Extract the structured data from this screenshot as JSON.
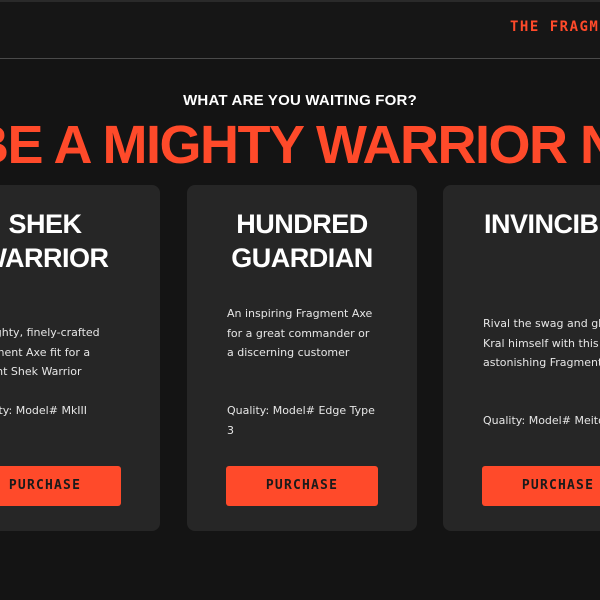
{
  "header": {
    "brand": "THE FRAGMENT"
  },
  "hero": {
    "eyebrow": "WHAT ARE YOU WAITING FOR?",
    "headline": "BE A MIGHTY WARRIOR NOW!"
  },
  "cards": [
    {
      "title_line1": "SHEK",
      "title_line2": "WARRIOR",
      "description": "A mighty, finely-crafted Fragment Axe fit for a valiant Shek Warrior",
      "quality": "Quality: Model# MkIII",
      "button_label": "PURCHASE"
    },
    {
      "title_line1": "HUNDRED",
      "title_line2": "GUARDIAN",
      "description": "An inspiring Fragment Axe for a great commander or a discerning customer",
      "quality": "Quality: Model# Edge Type 3",
      "button_label": "PURCHASE"
    },
    {
      "title_line1": "INVINCIBLE",
      "title_line2": "",
      "description": "Rival the swag and glory of Kral himself with this astonishing Fragment Axe",
      "quality": "Quality: Model# Meitou",
      "button_label": "PURCHASE"
    }
  ],
  "colors": {
    "accent": "#ff4a2a",
    "background": "#141414",
    "card": "#262626"
  }
}
